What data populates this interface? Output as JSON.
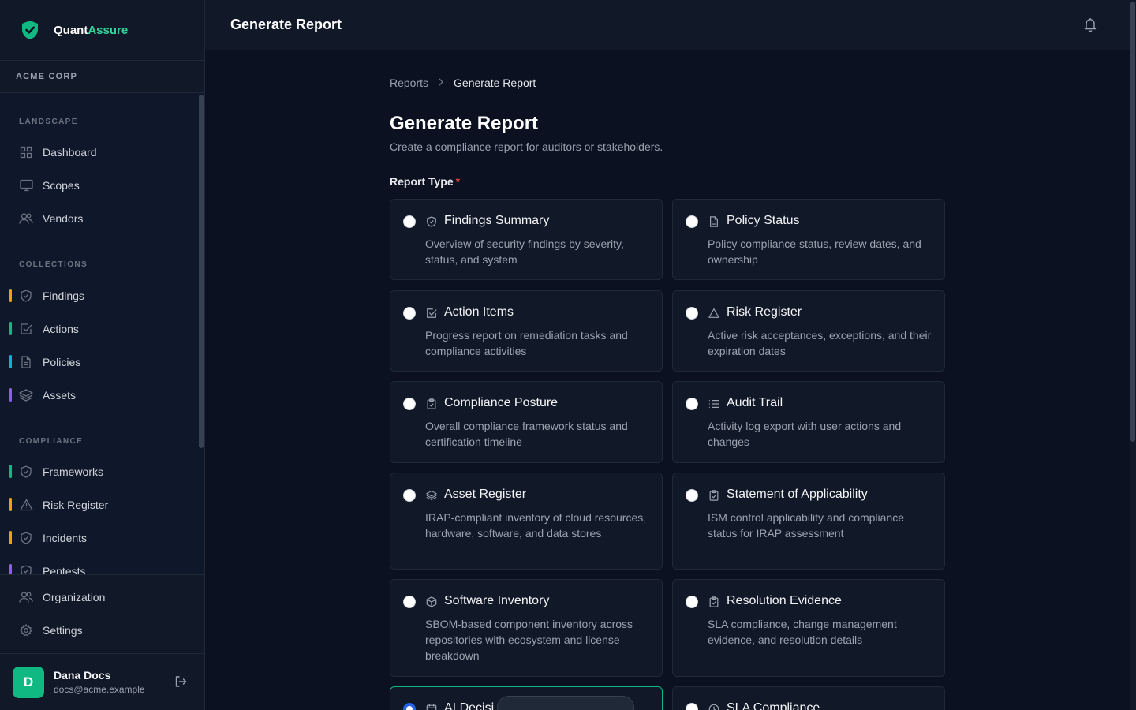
{
  "brand": {
    "name_a": "Quant",
    "name_b": "Assure",
    "accent_color": "#34d399"
  },
  "org": {
    "name": "ACME CORP"
  },
  "sidebar": {
    "sections": [
      {
        "label": "LANDSCAPE"
      },
      {
        "label": "COLLECTIONS"
      },
      {
        "label": "COMPLIANCE"
      }
    ],
    "items": [
      {
        "label": "Dashboard",
        "icon": "grid-icon"
      },
      {
        "label": "Scopes",
        "icon": "monitor-icon"
      },
      {
        "label": "Vendors",
        "icon": "users-icon"
      },
      {
        "label": "Findings",
        "icon": "shield-icon",
        "bar_color": "#f59e0b"
      },
      {
        "label": "Actions",
        "icon": "check-square-icon",
        "bar_color": "#10b981"
      },
      {
        "label": "Policies",
        "icon": "file-icon",
        "bar_color": "#06b6d4"
      },
      {
        "label": "Assets",
        "icon": "layers-icon",
        "bar_color": "#8b5cf6"
      },
      {
        "label": "Frameworks",
        "icon": "shield-icon",
        "bar_color": "#10b981"
      },
      {
        "label": "Risk Register",
        "icon": "warning-icon",
        "bar_color": "#f59e0b"
      },
      {
        "label": "Incidents",
        "icon": "shield-icon",
        "bar_color": "#f59e0b"
      },
      {
        "label": "Pentests",
        "icon": "shield-icon",
        "bar_color": "#8b5cf6"
      }
    ],
    "bottom": [
      {
        "label": "Organization",
        "icon": "users-icon"
      },
      {
        "label": "Settings",
        "icon": "gear-icon"
      }
    ]
  },
  "user": {
    "initial": "D",
    "name": "Dana Docs",
    "email": "docs@acme.example"
  },
  "header": {
    "title": "Generate Report"
  },
  "breadcrumb": {
    "parent": "Reports",
    "current": "Generate Report"
  },
  "page": {
    "title": "Generate Report",
    "subtitle": "Create a compliance report for auditors or stakeholders.",
    "field_label": "Report Type",
    "required_mark": "*"
  },
  "report_types": [
    {
      "title": "Findings Summary",
      "desc": "Overview of security findings by severity, status, and system",
      "icon": "shield-icon"
    },
    {
      "title": "Policy Status",
      "desc": "Policy compliance status, review dates, and ownership",
      "icon": "file-icon"
    },
    {
      "title": "Action Items",
      "desc": "Progress report on remediation tasks and compliance activities",
      "icon": "check-square-icon"
    },
    {
      "title": "Risk Register",
      "desc": "Active risk acceptances, exceptions, and their expiration dates",
      "icon": "warning-icon"
    },
    {
      "title": "Compliance Posture",
      "desc": "Overall compliance framework status and certification timeline",
      "icon": "clipboard-icon"
    },
    {
      "title": "Audit Trail",
      "desc": "Activity log export with user actions and changes",
      "icon": "list-icon"
    },
    {
      "title": "Asset Register",
      "desc": "IRAP-compliant inventory of cloud resources, hardware, software, and data stores",
      "icon": "layers-icon"
    },
    {
      "title": "Statement of Applicability",
      "desc": "ISM control applicability and compliance status for IRAP assessment",
      "icon": "clipboard-icon"
    },
    {
      "title": "Software Inventory",
      "desc": "SBOM-based component inventory across repositories with ecosystem and license breakdown",
      "icon": "package-icon"
    },
    {
      "title": "Resolution Evidence",
      "desc": "SLA compliance, change management evidence, and resolution details",
      "icon": "clipboard-icon"
    },
    {
      "title": "AI Decisi",
      "desc": "",
      "icon": "calendar-icon",
      "selected": true
    },
    {
      "title": "SLA Compliance",
      "desc": "",
      "icon": "clock-icon"
    }
  ]
}
